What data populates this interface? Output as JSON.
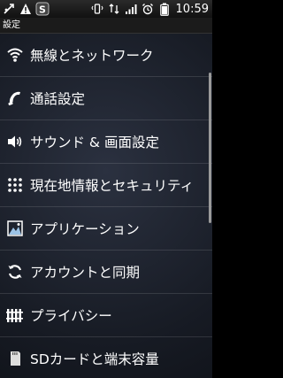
{
  "statusbar": {
    "time": "10:59",
    "left_icons": [
      "usb-icon",
      "warning-icon",
      "app-s-icon"
    ],
    "right_icons": [
      "vibrate-icon",
      "data-icon",
      "signal-icon",
      "alarm-icon",
      "battery-icon"
    ],
    "app_badge": "S"
  },
  "screen": {
    "title": "設定"
  },
  "menu": {
    "items": [
      {
        "label": "無線とネットワーク",
        "icon": "wifi-icon"
      },
      {
        "label": "通話設定",
        "icon": "phone-icon"
      },
      {
        "label": "サウンド & 画面設定",
        "icon": "speaker-icon"
      },
      {
        "label": "現在地情報とセキュリティ",
        "icon": "location-grid-icon"
      },
      {
        "label": "アプリケーション",
        "icon": "applications-icon"
      },
      {
        "label": "アカウントと同期",
        "icon": "sync-icon"
      },
      {
        "label": "プライバシー",
        "icon": "privacy-icon"
      },
      {
        "label": "SDカードと端末容量",
        "icon": "sd-card-icon"
      }
    ]
  }
}
